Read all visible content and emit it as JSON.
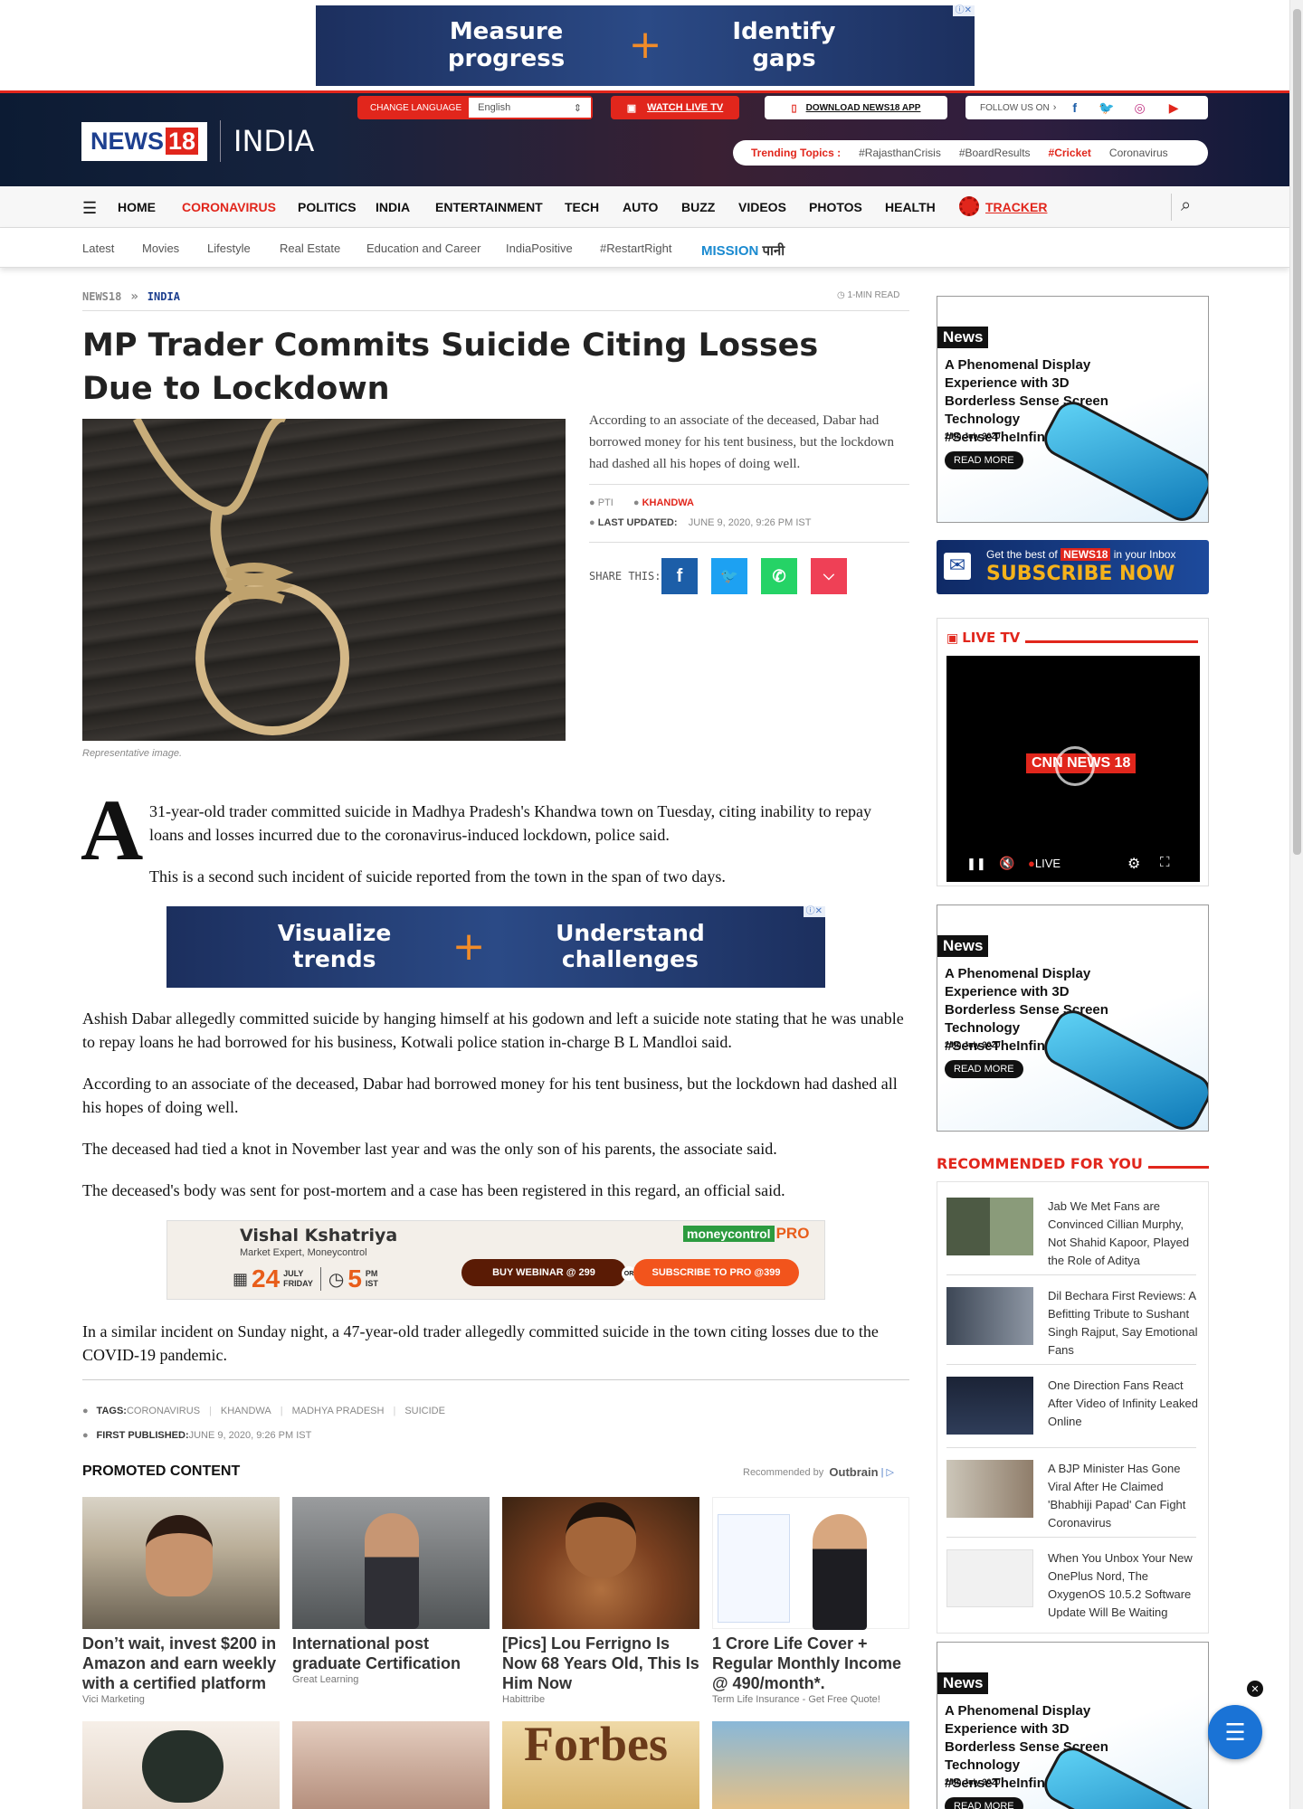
{
  "top_ad": {
    "left": "Measure progress",
    "right": "Identify gaps"
  },
  "header": {
    "logo": "NEWS18",
    "logo_num": "18",
    "section": "INDIA",
    "change_language": "CHANGE LANGUAGE",
    "language_value": "English",
    "watch_live": "WATCH LIVE TV",
    "download_app": "DOWNLOAD NEWS18 APP",
    "follow_us": "FOLLOW US ON",
    "trending_label": "Trending Topics :",
    "trending": [
      "#RajasthanCrisis",
      "#BoardResults",
      "#Cricket",
      "Coronavirus"
    ]
  },
  "nav": {
    "items": [
      "HOME",
      "CORONAVIRUS",
      "POLITICS",
      "INDIA",
      "ENTERTAINMENT",
      "TECH",
      "AUTO",
      "BUZZ",
      "VIDEOS",
      "PHOTOS",
      "HEALTH"
    ],
    "tracker": "TRACKER"
  },
  "subnav": {
    "items": [
      "Latest",
      "Movies",
      "Lifestyle",
      "Real Estate",
      "Education and Career",
      "IndiaPositive",
      "#RestartRight"
    ],
    "mission": "MISSION",
    "mission_hi": "पानी"
  },
  "breadcrumb": {
    "home": "NEWS18",
    "sep": "»",
    "section": "INDIA",
    "read_time": "1-MIN READ"
  },
  "article": {
    "title": "MP Trader Commits Suicide Citing Losses Due to Lockdown",
    "caption": "Representative image.",
    "summary": "According to an associate of the deceased, Dabar had borrowed money for his tent business, but the lockdown had dashed all his hopes of doing well.",
    "agency": "PTI",
    "location": "KHANDWA",
    "last_updated_label": "LAST UPDATED:",
    "last_updated": "JUNE 9, 2020, 9:26 PM IST",
    "share_label": "SHARE THIS:",
    "dropcap": "A",
    "p1": "31-year-old trader committed suicide in Madhya Pradesh's Khandwa town on Tuesday, citing inability to repay loans and losses incurred due to the coronavirus-induced lockdown, police said.",
    "p2": "This is a second such incident of suicide reported from the town in the span of two days.",
    "p3": "Ashish Dabar allegedly committed suicide by hanging himself at his godown and left a suicide note stating that he was unable to repay loans he had borrowed for his business, Kotwali police station in-charge B L Mandloi said.",
    "p4": "According to an associate of the deceased, Dabar had borrowed money for his tent business, but the lockdown had dashed all his hopes of doing well.",
    "p5": "The deceased had tied a knot in November last year and was the only son of his parents, the associate said.",
    "p6": "The deceased's body was sent for post-mortem and a case has been registered in this regard, an official said.",
    "p7": "In a similar incident on Sunday night, a 47-year-old trader allegedly committed suicide in the town citing losses due to the COVID-19 pandemic.",
    "tags_label": "TAGS:",
    "tags": [
      "CORONAVIRUS",
      "KHANDWA",
      "MADHYA PRADESH",
      "SUICIDE"
    ],
    "first_published_label": "FIRST PUBLISHED:",
    "first_published": "JUNE 9, 2020, 9:26 PM IST"
  },
  "mid_ad": {
    "left": "Visualize trends",
    "right": "Understand challenges"
  },
  "mc_ad": {
    "name": "Vishal Kshatriya",
    "role": "Market Expert, Moneycontrol",
    "brand": "moneycontrol",
    "pro": "PRO",
    "day": "24",
    "month": "JULY",
    "weekday": "FRIDAY",
    "time": "5",
    "ampm": "PM",
    "tz": "IST",
    "btn1": "BUY WEBINAR @ 299",
    "or": "OR",
    "btn2": "SUBSCRIBE TO PRO @399"
  },
  "side_ad": {
    "badge": "News",
    "text": "A Phenomenal Display Experience with 3D Borderless Sense Screen Technology #SenseTheInfinite",
    "date": "24th July 2020",
    "btn": "READ MORE"
  },
  "subscribe": {
    "pre": "Get the best of",
    "brand": "NEWS18",
    "post": "in your Inbox",
    "cta": "SUBSCRIBE NOW"
  },
  "live_tv": {
    "title": "LIVE TV",
    "channel": "CNN NEWS 18",
    "live": "LIVE"
  },
  "recommended": {
    "title": "RECOMMENDED FOR YOU",
    "items": [
      "Jab We Met Fans are Convinced Cillian Murphy, Not Shahid Kapoor, Played the Role of Aditya",
      "Dil Bechara First Reviews: A Befitting Tribute to Sushant Singh Rajput, Say Emotional Fans",
      "One Direction Fans React After Video of Infinity Leaked Online",
      "A BJP Minister Has Gone Viral After He Claimed 'Bhabhiji Papad' Can Fight Coronavirus",
      "When You Unbox Your New OnePlus Nord, The OxygenOS 10.5.2 Software Update Will Be Waiting"
    ]
  },
  "promoted": {
    "title": "PROMOTED CONTENT",
    "recommended_by": "Recommended by",
    "outbrain": "Outbrain",
    "items": [
      {
        "headline": "Don’t wait, invest $200 in Amazon and earn weekly with a certified platform",
        "source": "Vici Marketing"
      },
      {
        "headline": "International post graduate Certification",
        "source": "Great Learning"
      },
      {
        "headline": "[Pics] Lou Ferrigno Is Now 68 Years Old, This Is Him Now",
        "source": "Habittribe"
      },
      {
        "headline": "1 Crore Life Cover + Regular Monthly Income @ 490/month*.",
        "source": "Term Life Insurance - Get Free Quote!"
      }
    ]
  },
  "colors": {
    "brand_red": "#e1261c",
    "facebook": "#1c5ea8",
    "twitter": "#1da1f2",
    "whatsapp": "#25d366",
    "pocket": "#ef4056"
  }
}
